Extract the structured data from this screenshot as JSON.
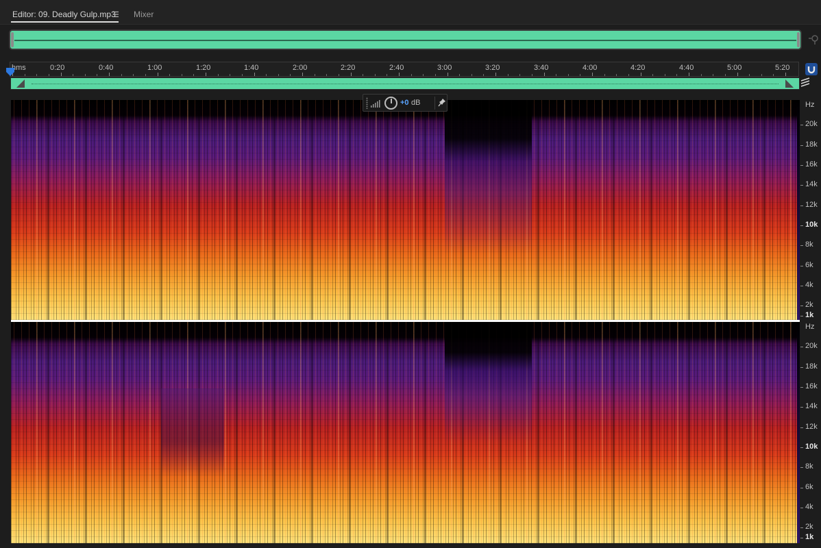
{
  "tabs": {
    "editor_label": "Editor: 09. Deadly Gulp.mp3",
    "editor_menu_icon": "hamburger-menu-icon",
    "mixer_label": "Mixer"
  },
  "ruler": {
    "unit_label": "hms",
    "ticks": [
      "0:20",
      "0:40",
      "1:00",
      "1:20",
      "1:40",
      "2:00",
      "2:20",
      "2:40",
      "3:00",
      "3:20",
      "3:40",
      "4:00",
      "4:20",
      "4:40",
      "5:00",
      "5:20"
    ]
  },
  "hud": {
    "gain_value": "+0",
    "gain_unit": "dB"
  },
  "frequency_scale": {
    "unit": "Hz",
    "labels": [
      {
        "text": "20k",
        "bold": false
      },
      {
        "text": "18k",
        "bold": false
      },
      {
        "text": "16k",
        "bold": false
      },
      {
        "text": "14k",
        "bold": false
      },
      {
        "text": "12k",
        "bold": false
      },
      {
        "text": "10k",
        "bold": true
      },
      {
        "text": "8k",
        "bold": false
      },
      {
        "text": "6k",
        "bold": false
      },
      {
        "text": "4k",
        "bold": false
      },
      {
        "text": "2k",
        "bold": false
      },
      {
        "text": "1k",
        "bold": true
      }
    ]
  },
  "colors": {
    "waveform": "#5bd7a3",
    "accent": "#5aa4ff",
    "panel": "#1d1d1d"
  }
}
